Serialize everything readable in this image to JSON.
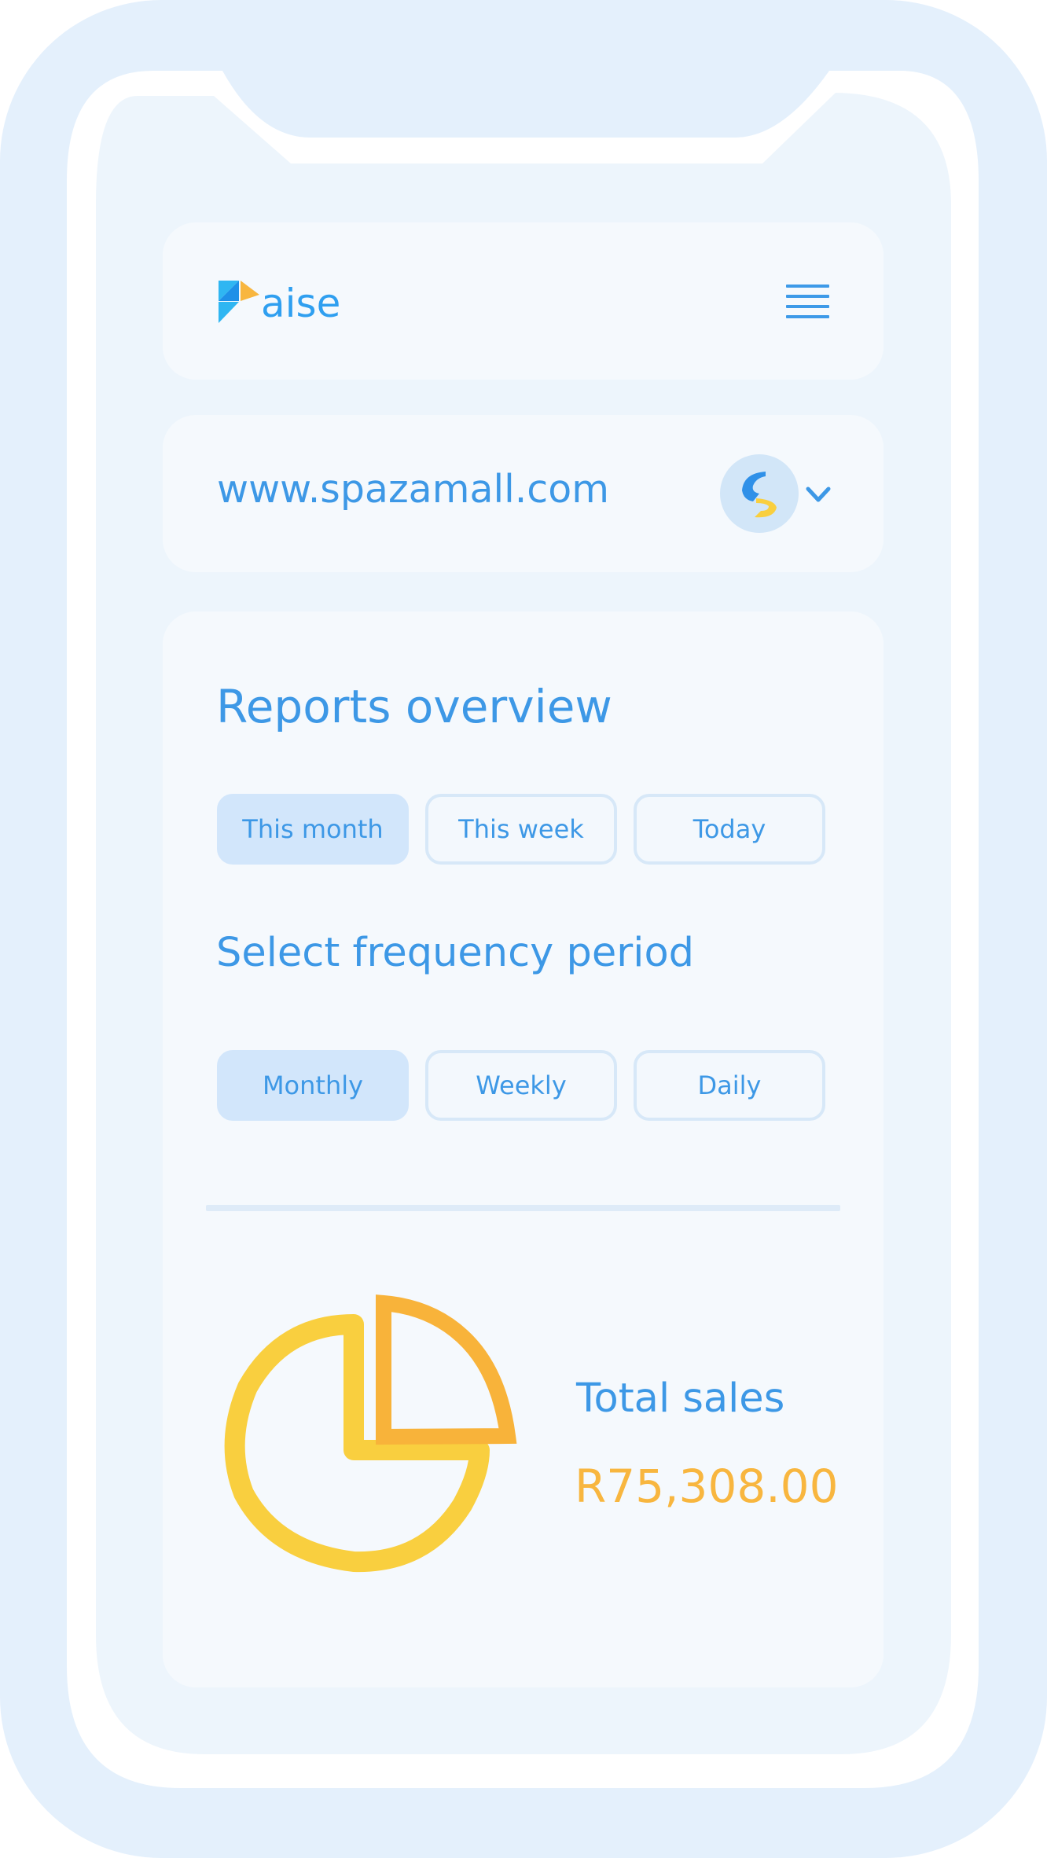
{
  "brand": {
    "name": "aise",
    "colors": {
      "primary": "#3d98e6",
      "accent_orange": "#f8b63f",
      "accent_yellow": "#f9cf3f",
      "card_bg": "#f5f9fd",
      "active_pill": "#d2e6fb"
    }
  },
  "header": {
    "logo_text": "aise",
    "menu_icon": "hamburger-menu-icon"
  },
  "site_selector": {
    "url": "www.spazamall.com",
    "avatar_icon": "store-logo-icon",
    "dropdown_icon": "chevron-down-icon"
  },
  "reports": {
    "title": "Reports overview",
    "range_tabs": [
      {
        "label": "This month",
        "active": true
      },
      {
        "label": "This week",
        "active": false
      },
      {
        "label": "Today",
        "active": false
      }
    ],
    "frequency_title": "Select frequency period",
    "frequency_tabs": [
      {
        "label": "Monthly",
        "active": true
      },
      {
        "label": "Weekly",
        "active": false
      },
      {
        "label": "Daily",
        "active": false
      }
    ]
  },
  "summary": {
    "icon": "pie-chart-icon",
    "label": "Total sales",
    "value": "R75,308.00"
  }
}
